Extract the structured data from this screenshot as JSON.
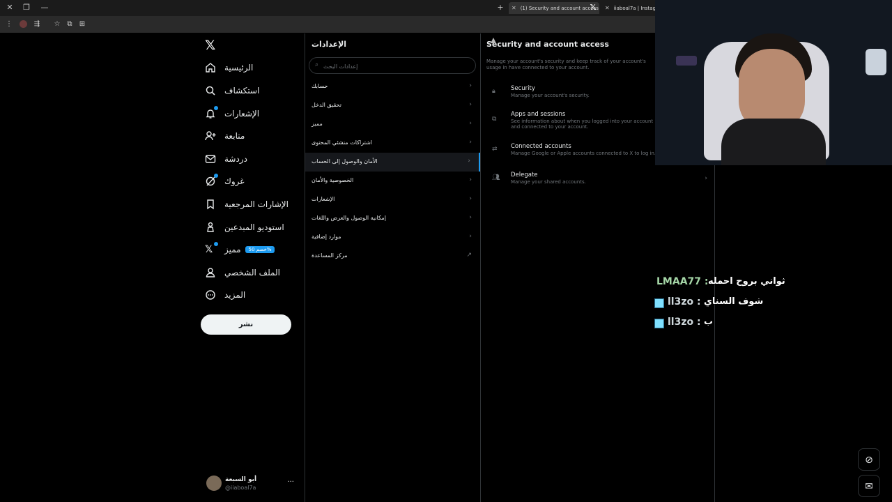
{
  "browser": {
    "tabs": [
      {
        "title": "(1) Security and account access",
        "active": true
      },
      {
        "title": "iiaboal7a | Instagram",
        "active": false
      }
    ],
    "new_tab_label": "+",
    "window": {
      "close": "✕",
      "restore": "❐",
      "minimize": "—"
    }
  },
  "nav": {
    "logo": "𝕏",
    "items": [
      {
        "label": "الرئيسية",
        "icon": "home-icon"
      },
      {
        "label": "استكشاف",
        "icon": "search-icon"
      },
      {
        "label": "الإشعارات",
        "icon": "bell-icon",
        "badge": true
      },
      {
        "label": "متابعة",
        "icon": "follow-icon"
      },
      {
        "label": "دردشة",
        "icon": "mail-icon"
      },
      {
        "label": "غروك",
        "icon": "grok-icon"
      },
      {
        "label": "الإشارات المرجعية",
        "icon": "bookmark-icon"
      },
      {
        "label": "استوديو المبدعين",
        "icon": "creator-studio-icon"
      },
      {
        "label": "مميز",
        "icon": "x-premium-icon",
        "badge": true,
        "promo": "خصم 50%"
      },
      {
        "label": "الملف الشخصي",
        "icon": "profile-icon"
      },
      {
        "label": "المزيد",
        "icon": "more-icon"
      }
    ],
    "post_button": "نشر",
    "profile": {
      "name": "أبو السبعة",
      "handle": "@iiaboal7a",
      "more": "···"
    }
  },
  "settings": {
    "title": "الإعدادات",
    "search_placeholder": "إعدادات البحث",
    "items": [
      {
        "label": "حسابك",
        "chevron": "›"
      },
      {
        "label": "تحقيق الدخل",
        "chevron": "›"
      },
      {
        "label": "مميز",
        "chevron": "›"
      },
      {
        "label": "اشتراكات منشئي المحتوى",
        "chevron": "›"
      },
      {
        "label": "الأمان والوصول إلى الحساب",
        "chevron": "›",
        "active": true
      },
      {
        "label": "الخصوصية والأمان",
        "chevron": "›"
      },
      {
        "label": "الإشعارات",
        "chevron": "›"
      },
      {
        "label": "إمكانية الوصول والعرض واللغات",
        "chevron": "›"
      },
      {
        "label": "موارد إضافية",
        "chevron": "›"
      },
      {
        "label": "مركز المساعدة",
        "chevron": "↗"
      }
    ]
  },
  "detail": {
    "title": "Security and account access",
    "description": "Manage your account's security and keep track of your account's usage in have connected to your account.",
    "items": [
      {
        "title": "Security",
        "subtitle": "Manage your account's security.",
        "icon": "lock-icon"
      },
      {
        "title": "Apps and sessions",
        "subtitle": "See information about when you logged into your account and connected to your account.",
        "icon": "apps-icon"
      },
      {
        "title": "Connected accounts",
        "subtitle": "Manage Google or Apple accounts connected to X to log in.",
        "icon": "swap-icon"
      },
      {
        "title": "Delegate",
        "subtitle": "Manage your shared accounts.",
        "icon": "people-icon",
        "chevron": "›"
      }
    ]
  },
  "stream_chat": [
    {
      "user": "LMAA77 :",
      "message": "ثواني بروح احمله",
      "user_color": "#a5d6a7",
      "badge": false
    },
    {
      "user": "ll3zo :",
      "message": "شوف السناي",
      "user_color": "#cfd8dc",
      "badge": true
    },
    {
      "user": "ll3zo :",
      "message": "ب",
      "user_color": "#cfd8dc",
      "badge": true
    }
  ],
  "floating": {
    "grok": "⊘",
    "messages": "✉"
  },
  "colors": {
    "accent": "#1d9bf0",
    "background": "#000000",
    "border": "#2f3336",
    "muted": "#71767b"
  }
}
